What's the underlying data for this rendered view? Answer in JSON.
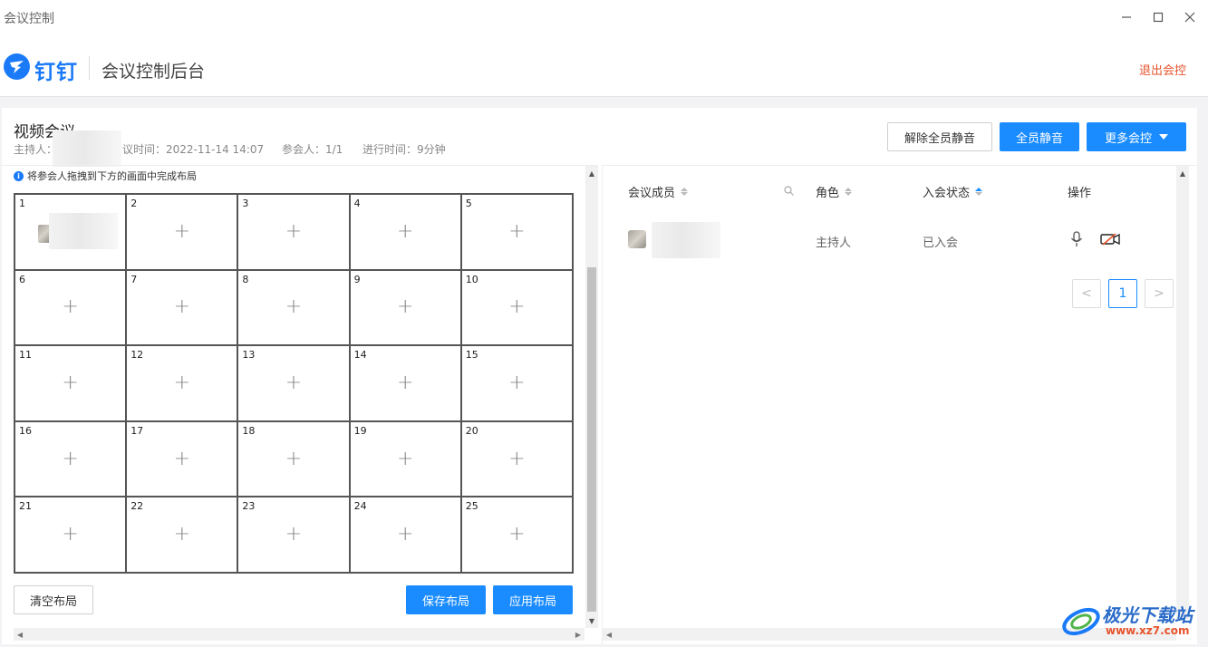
{
  "window": {
    "title": "会议控制"
  },
  "header": {
    "logo_text": "钉钉",
    "app_title": "会议控制后台",
    "exit_label": "退出会控"
  },
  "meeting": {
    "title": "视频会议",
    "host_label": "主持人：",
    "time_label": "议时间：2022-11-14 14:07",
    "participants_label": "参会人：1/1",
    "duration_label": "进行时间：9分钟"
  },
  "actions": {
    "unmute_all": "解除全员静音",
    "mute_all": "全员静音",
    "more": "更多会控"
  },
  "layout": {
    "hint": "将参会人拖拽到下方的画面中完成布局",
    "cells": [
      "1",
      "2",
      "3",
      "4",
      "5",
      "6",
      "7",
      "8",
      "9",
      "10",
      "11",
      "12",
      "13",
      "14",
      "15",
      "16",
      "17",
      "18",
      "19",
      "20",
      "21",
      "22",
      "23",
      "24",
      "25"
    ],
    "plus": "+",
    "clear_label": "清空布局",
    "save_label": "保存布局",
    "apply_label": "应用布局"
  },
  "members": {
    "columns": {
      "member": "会议成员",
      "role": "角色",
      "status": "入会状态",
      "ops": "操作"
    },
    "rows": [
      {
        "role": "主持人",
        "status": "已入会"
      }
    ],
    "pagination": {
      "prev": "<",
      "current": "1",
      "next": ">"
    }
  },
  "watermark": {
    "text": "极光下载站",
    "url": "www.xz7.com"
  },
  "colors": {
    "accent": "#1a8cff",
    "danger": "#e7532c",
    "logo": "#1a7af8"
  }
}
